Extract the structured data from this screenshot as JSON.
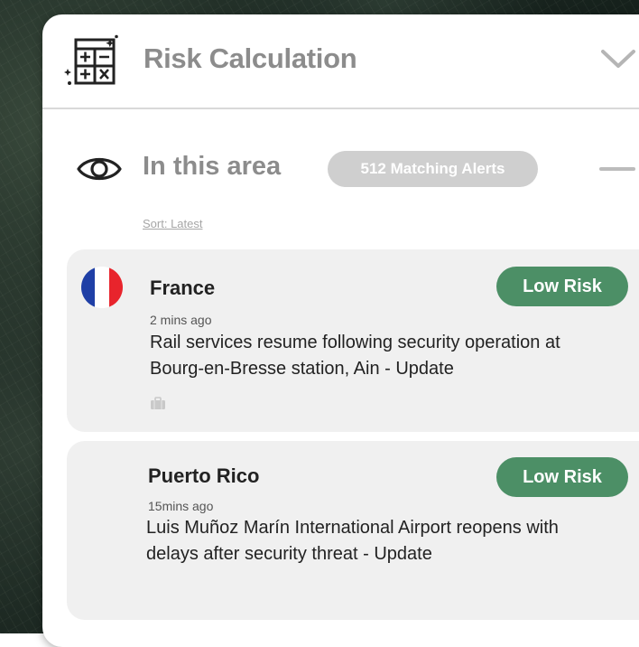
{
  "header": {
    "title": "Risk Calculation",
    "icon": "calculator-icon",
    "toggle_icon": "chevron-down-icon"
  },
  "area": {
    "title": "In this area",
    "icon": "eye-icon",
    "alerts_label": "512 Matching Alerts",
    "sort_label": "Sort: Latest"
  },
  "alerts": [
    {
      "country": "France",
      "flag_colors": [
        "#1f3fa6",
        "#ffffff",
        "#e8242c"
      ],
      "time": "2 mins ago",
      "description": "Rail services resume following security operation at Bourg-en-Bresse station, Ain - Update",
      "risk": "Low Risk",
      "category_icon": "briefcase-icon"
    },
    {
      "country": "Puerto Rico",
      "time": "15mins ago",
      "description": "Luis Muñoz Marín International Airport reopens with delays after security threat - Update",
      "risk": "Low Risk"
    }
  ],
  "colors": {
    "low_risk": "#4c8f66",
    "title_gray": "#8c8c8c",
    "pill_gray": "#cfcfcf",
    "card_bg": "#f0f0f0"
  }
}
